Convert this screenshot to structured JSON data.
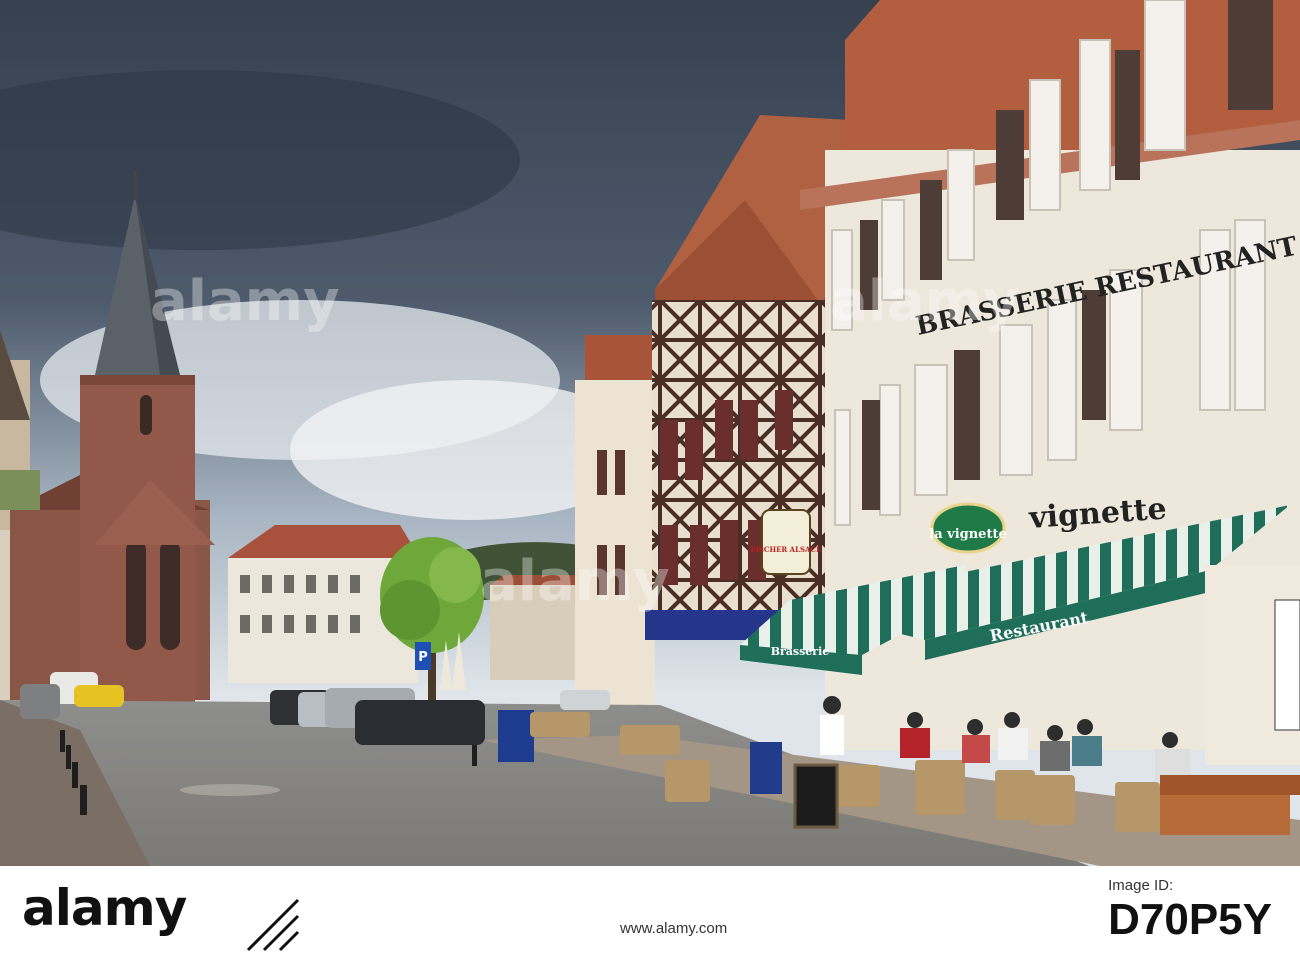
{
  "photo": {
    "description_alt": "",
    "signs": {
      "brasserie_restaurant": "BRASSERIE RESTAURANT",
      "vignette_wall": "vignette",
      "la_vignette_oval": "la vignette",
      "awning_restaurant": "Restaurant",
      "awning_brasserie": "Brasserie",
      "fischer": "FISCHER ALSACE",
      "parking": "P"
    }
  },
  "watermark": {
    "brand": "alamy"
  },
  "footer": {
    "logo": "alamy",
    "image_id_label": "Image ID:",
    "image_id": "D70P5Y",
    "url": "www.alamy.com"
  },
  "colors": {
    "sky_dark": "#3f4a5a",
    "sky_light": "#c9d4de",
    "church": "#8f5a48",
    "roof": "#a9553a",
    "awning_green": "#1f6e5a",
    "facade": "#ece6da"
  }
}
